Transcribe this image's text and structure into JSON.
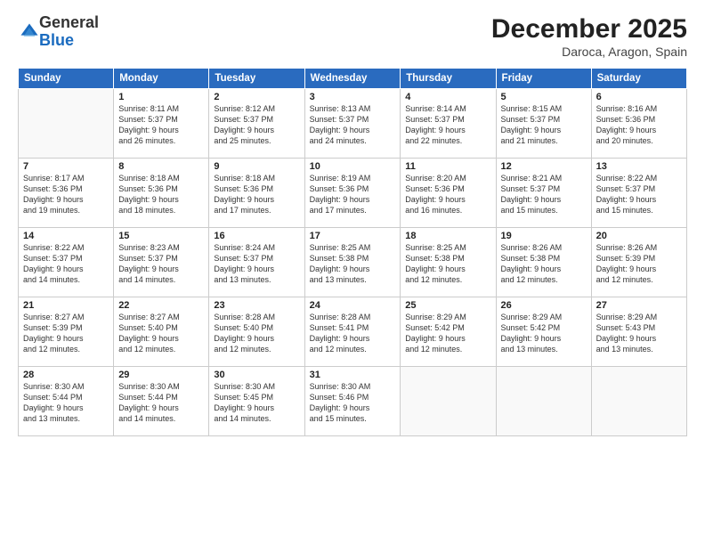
{
  "logo": {
    "general": "General",
    "blue": "Blue"
  },
  "title": "December 2025",
  "location": "Daroca, Aragon, Spain",
  "weekdays": [
    "Sunday",
    "Monday",
    "Tuesday",
    "Wednesday",
    "Thursday",
    "Friday",
    "Saturday"
  ],
  "weeks": [
    [
      {
        "day": "",
        "info": ""
      },
      {
        "day": "1",
        "info": "Sunrise: 8:11 AM\nSunset: 5:37 PM\nDaylight: 9 hours\nand 26 minutes."
      },
      {
        "day": "2",
        "info": "Sunrise: 8:12 AM\nSunset: 5:37 PM\nDaylight: 9 hours\nand 25 minutes."
      },
      {
        "day": "3",
        "info": "Sunrise: 8:13 AM\nSunset: 5:37 PM\nDaylight: 9 hours\nand 24 minutes."
      },
      {
        "day": "4",
        "info": "Sunrise: 8:14 AM\nSunset: 5:37 PM\nDaylight: 9 hours\nand 22 minutes."
      },
      {
        "day": "5",
        "info": "Sunrise: 8:15 AM\nSunset: 5:37 PM\nDaylight: 9 hours\nand 21 minutes."
      },
      {
        "day": "6",
        "info": "Sunrise: 8:16 AM\nSunset: 5:36 PM\nDaylight: 9 hours\nand 20 minutes."
      }
    ],
    [
      {
        "day": "7",
        "info": "Sunrise: 8:17 AM\nSunset: 5:36 PM\nDaylight: 9 hours\nand 19 minutes."
      },
      {
        "day": "8",
        "info": "Sunrise: 8:18 AM\nSunset: 5:36 PM\nDaylight: 9 hours\nand 18 minutes."
      },
      {
        "day": "9",
        "info": "Sunrise: 8:18 AM\nSunset: 5:36 PM\nDaylight: 9 hours\nand 17 minutes."
      },
      {
        "day": "10",
        "info": "Sunrise: 8:19 AM\nSunset: 5:36 PM\nDaylight: 9 hours\nand 17 minutes."
      },
      {
        "day": "11",
        "info": "Sunrise: 8:20 AM\nSunset: 5:36 PM\nDaylight: 9 hours\nand 16 minutes."
      },
      {
        "day": "12",
        "info": "Sunrise: 8:21 AM\nSunset: 5:37 PM\nDaylight: 9 hours\nand 15 minutes."
      },
      {
        "day": "13",
        "info": "Sunrise: 8:22 AM\nSunset: 5:37 PM\nDaylight: 9 hours\nand 15 minutes."
      }
    ],
    [
      {
        "day": "14",
        "info": "Sunrise: 8:22 AM\nSunset: 5:37 PM\nDaylight: 9 hours\nand 14 minutes."
      },
      {
        "day": "15",
        "info": "Sunrise: 8:23 AM\nSunset: 5:37 PM\nDaylight: 9 hours\nand 14 minutes."
      },
      {
        "day": "16",
        "info": "Sunrise: 8:24 AM\nSunset: 5:37 PM\nDaylight: 9 hours\nand 13 minutes."
      },
      {
        "day": "17",
        "info": "Sunrise: 8:25 AM\nSunset: 5:38 PM\nDaylight: 9 hours\nand 13 minutes."
      },
      {
        "day": "18",
        "info": "Sunrise: 8:25 AM\nSunset: 5:38 PM\nDaylight: 9 hours\nand 12 minutes."
      },
      {
        "day": "19",
        "info": "Sunrise: 8:26 AM\nSunset: 5:38 PM\nDaylight: 9 hours\nand 12 minutes."
      },
      {
        "day": "20",
        "info": "Sunrise: 8:26 AM\nSunset: 5:39 PM\nDaylight: 9 hours\nand 12 minutes."
      }
    ],
    [
      {
        "day": "21",
        "info": "Sunrise: 8:27 AM\nSunset: 5:39 PM\nDaylight: 9 hours\nand 12 minutes."
      },
      {
        "day": "22",
        "info": "Sunrise: 8:27 AM\nSunset: 5:40 PM\nDaylight: 9 hours\nand 12 minutes."
      },
      {
        "day": "23",
        "info": "Sunrise: 8:28 AM\nSunset: 5:40 PM\nDaylight: 9 hours\nand 12 minutes."
      },
      {
        "day": "24",
        "info": "Sunrise: 8:28 AM\nSunset: 5:41 PM\nDaylight: 9 hours\nand 12 minutes."
      },
      {
        "day": "25",
        "info": "Sunrise: 8:29 AM\nSunset: 5:42 PM\nDaylight: 9 hours\nand 12 minutes."
      },
      {
        "day": "26",
        "info": "Sunrise: 8:29 AM\nSunset: 5:42 PM\nDaylight: 9 hours\nand 13 minutes."
      },
      {
        "day": "27",
        "info": "Sunrise: 8:29 AM\nSunset: 5:43 PM\nDaylight: 9 hours\nand 13 minutes."
      }
    ],
    [
      {
        "day": "28",
        "info": "Sunrise: 8:30 AM\nSunset: 5:44 PM\nDaylight: 9 hours\nand 13 minutes."
      },
      {
        "day": "29",
        "info": "Sunrise: 8:30 AM\nSunset: 5:44 PM\nDaylight: 9 hours\nand 14 minutes."
      },
      {
        "day": "30",
        "info": "Sunrise: 8:30 AM\nSunset: 5:45 PM\nDaylight: 9 hours\nand 14 minutes."
      },
      {
        "day": "31",
        "info": "Sunrise: 8:30 AM\nSunset: 5:46 PM\nDaylight: 9 hours\nand 15 minutes."
      },
      {
        "day": "",
        "info": ""
      },
      {
        "day": "",
        "info": ""
      },
      {
        "day": "",
        "info": ""
      }
    ]
  ]
}
